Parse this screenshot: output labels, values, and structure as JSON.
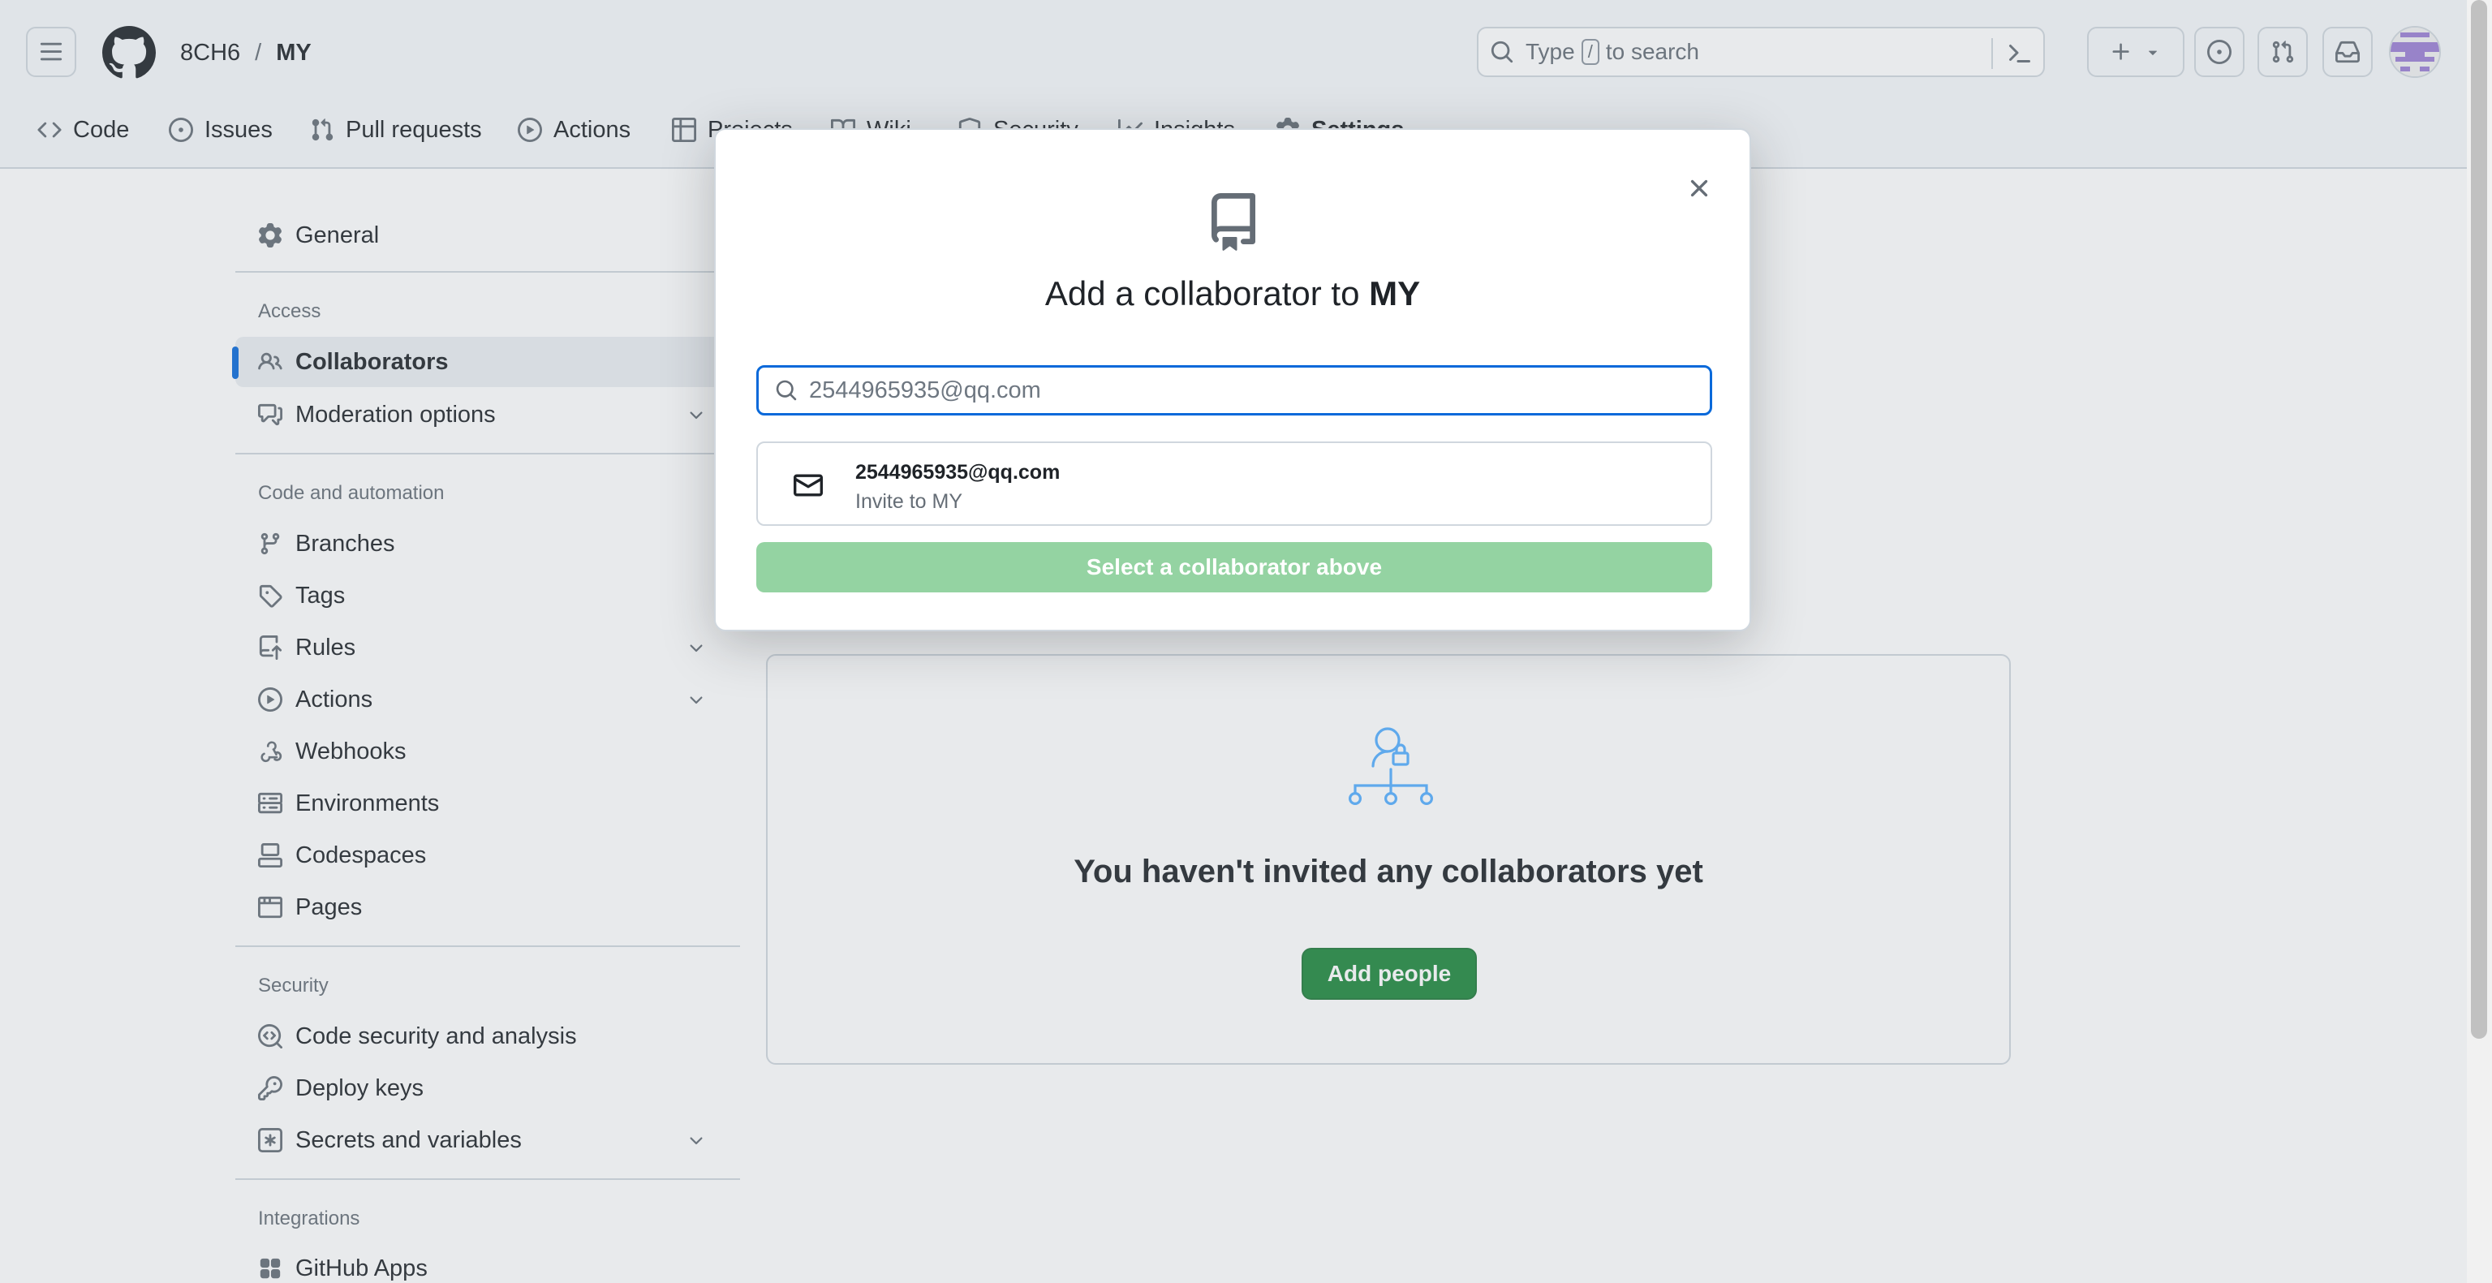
{
  "header": {
    "owner": "8CH6",
    "separator": "/",
    "repo": "MY",
    "search": {
      "prefix": "Type",
      "key": "/",
      "suffix": "to search"
    }
  },
  "repo_tabs": [
    {
      "label": "Code",
      "icon": "code-icon"
    },
    {
      "label": "Issues",
      "icon": "issue-opened-icon"
    },
    {
      "label": "Pull requests",
      "icon": "git-pull-request-icon"
    },
    {
      "label": "Actions",
      "icon": "play-icon"
    },
    {
      "label": "Projects",
      "icon": "table-icon"
    },
    {
      "label": "Wiki",
      "icon": "book-icon"
    },
    {
      "label": "Security",
      "icon": "shield-icon"
    },
    {
      "label": "Insights",
      "icon": "graph-icon"
    },
    {
      "label": "Settings",
      "icon": "gear-icon"
    }
  ],
  "sidebar": {
    "general": "General",
    "access_heading": "Access",
    "collaborators": "Collaborators",
    "moderation": "Moderation options",
    "code_heading": "Code and automation",
    "branches": "Branches",
    "tags": "Tags",
    "rules": "Rules",
    "actions": "Actions",
    "webhooks": "Webhooks",
    "environments": "Environments",
    "codespaces": "Codespaces",
    "pages": "Pages",
    "security_heading": "Security",
    "code_security": "Code security and analysis",
    "deploy_keys": "Deploy keys",
    "secrets": "Secrets and variables",
    "integrations_heading": "Integrations",
    "github_apps": "GitHub Apps"
  },
  "blankslate": {
    "title": "You haven't invited any collaborators yet",
    "button": "Add people"
  },
  "dialog": {
    "title_prefix": "Add a collaborator to",
    "title_repo": "MY",
    "search_value": "2544965935@qq.com",
    "suggestion_email": "2544965935@qq.com",
    "suggestion_sub": "Invite to MY",
    "select_button": "Select a collaborator above"
  },
  "colors": {
    "accent": "#0969da",
    "primary_button": "#1f883d",
    "disabled_button": "#94d3a2",
    "illustration": "#54aeff"
  }
}
